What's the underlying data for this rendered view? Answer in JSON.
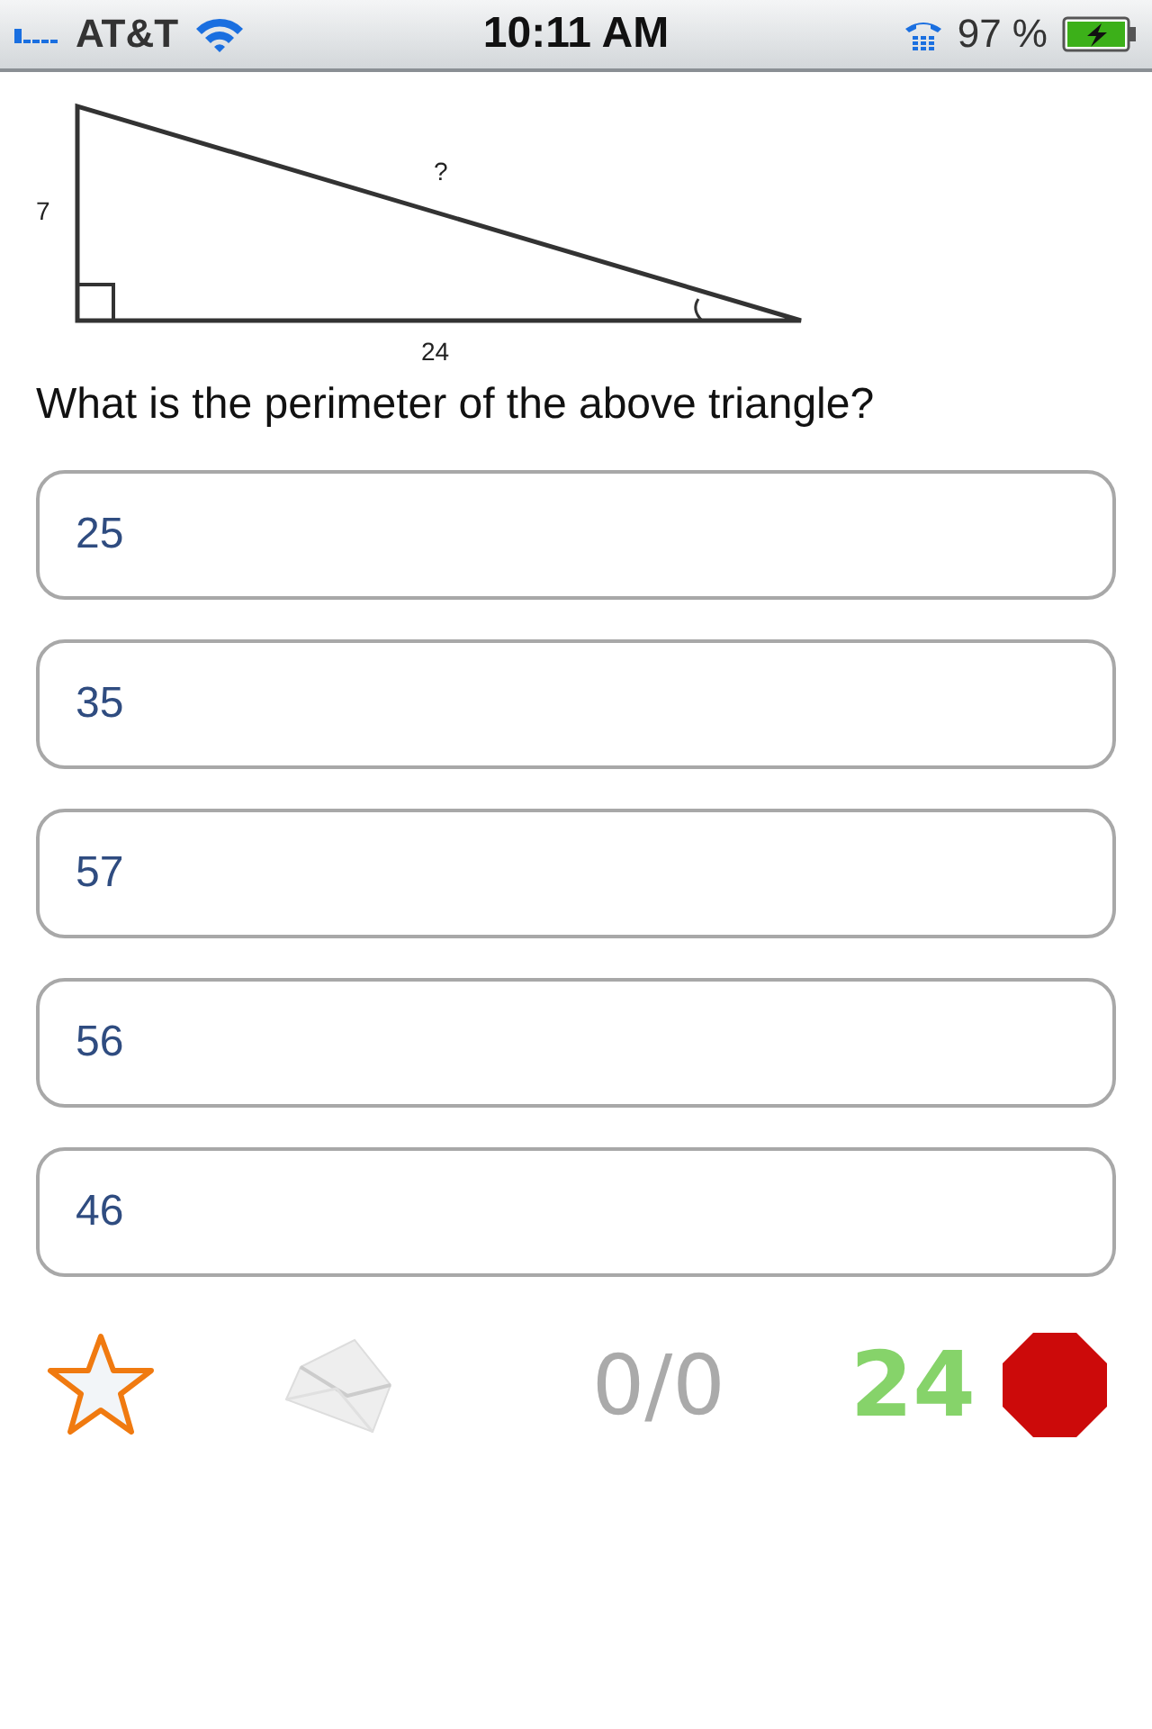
{
  "status_bar": {
    "carrier": "AT&T",
    "time": "10:11 AM",
    "battery": "97 %"
  },
  "diagram": {
    "side_a": "7",
    "side_b": "24",
    "hypotenuse": "?"
  },
  "question": "What is the perimeter of the above triangle?",
  "answers": [
    {
      "label": "25"
    },
    {
      "label": "35"
    },
    {
      "label": "57"
    },
    {
      "label": "56"
    },
    {
      "label": "46"
    }
  ],
  "footer": {
    "score": "0/0",
    "timer": "24"
  }
}
